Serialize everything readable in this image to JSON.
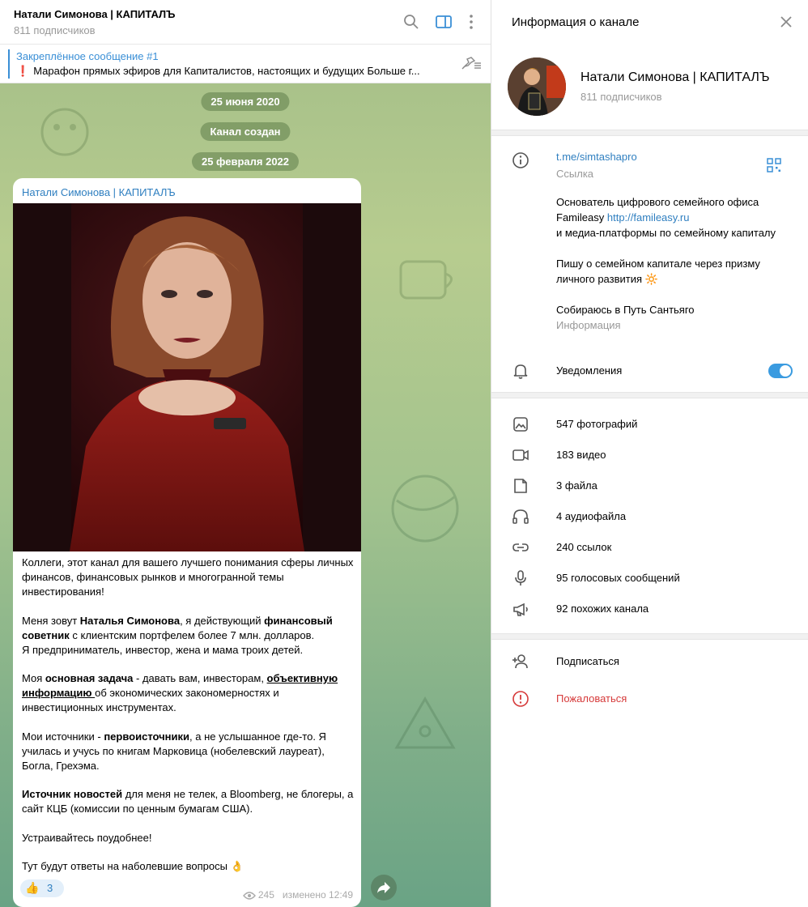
{
  "chat": {
    "title": "Натали Симонова | КАПИТАЛЪ",
    "subscribers": "811 подписчиков",
    "pinned_title": "Закреплённое сообщение #1",
    "pinned_text": "Марафон прямых эфиров для Капиталистов, настоящих и будущих    Больше г...",
    "dates": [
      "25 июня 2020",
      "Канал создан",
      "25 февраля 2022"
    ],
    "message": {
      "author": "Натали Симонова | КАПИТАЛЪ",
      "p1": "Коллеги, этот канал для вашего лучшего понимания сферы личных финансов, финансовых рынков и многогранной темы инвестирования!",
      "p2a": "Меня зовут ",
      "p2b": "Наталья Симонова",
      "p2c": ", я действующий ",
      "p2d": "финансовый советник",
      "p2e": " с клиентским портфелем более 7 млн. долларов.",
      "p2f": "Я предприниматель, инвестор, жена и мама троих детей.",
      "p3a": "Моя ",
      "p3b": "основная задача",
      "p3c": " - давать вам, инвесторам, ",
      "p3d": "объективную информацию ",
      "p3e": "об экономических закономерностях и инвестиционных инструментах.",
      "p4a": "Мои источники - ",
      "p4b": "первоисточники",
      "p4c": ", а не  услышанное где-то. Я училась и учусь по книгам Марковица (нобелевский лауреат), Богла, Грехэма.",
      "p5a": "Источник новостей",
      "p5b": " для меня не телек, а Bloomberg, не блогеры, а сайт КЦБ (комиссии по ценным бумагам США).",
      "p6": "Устраивайтесь поудобнее!",
      "p7": "Тут будут ответы на наболевшие вопросы 👌",
      "reaction_emoji": "👍",
      "reaction_count": "3",
      "views": "245",
      "edited": "изменено 12:49"
    }
  },
  "info": {
    "title": "Информация о канале",
    "name": "Натали Симонова | КАПИТАЛЪ",
    "subscribers": "811 подписчиков",
    "link": "t.me/simtashapro",
    "link_label": "Ссылка",
    "about1": "Основатель цифрового семейного офиса Familеasy ",
    "about_link": "http://familеasy.ru",
    "about2": "и медиа-платформы по семейному капиталу",
    "about3": "Пишу о семейном капитале через призму личного развития 🔆",
    "about4": "Собираюсь в Путь Сантьяго",
    "about_label": "Информация",
    "notifications": "Уведомления",
    "notifications_on": true,
    "media": [
      {
        "label": "547 фотографий",
        "icon": "photo-icon"
      },
      {
        "label": "183 видео",
        "icon": "video-icon"
      },
      {
        "label": "3 файла",
        "icon": "file-icon"
      },
      {
        "label": "4 аудиофайла",
        "icon": "headphones-icon"
      },
      {
        "label": "240 ссылок",
        "icon": "link-icon"
      },
      {
        "label": "95 голосовых сообщений",
        "icon": "microphone-icon"
      },
      {
        "label": "92 похожих канала",
        "icon": "megaphone-icon"
      }
    ],
    "subscribe": "Подписаться",
    "report": "Пожаловаться"
  },
  "colors": {
    "accent": "#3a8fd6",
    "danger": "#d63a3a",
    "toggle": "#3a9be0"
  }
}
